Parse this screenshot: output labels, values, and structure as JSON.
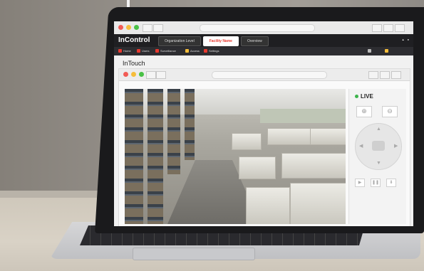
{
  "app": {
    "logo": "InControl",
    "crumbs": [
      "Organization Level",
      "Facility Name",
      "Overview"
    ],
    "toolbar": [
      "Home",
      "Users",
      "Surveillance",
      "Access",
      "Settings"
    ],
    "page_title": "InTouch",
    "live_label": "LIVE"
  },
  "colors": {
    "accent_red": "#e8392f",
    "live_green": "#3cb44b",
    "dot_red": "#f25b55",
    "dot_yellow": "#f6bd3b",
    "dot_green": "#49c146"
  },
  "icons": {
    "zoom_in": "zoom-in-icon",
    "zoom_out": "zoom-out-icon",
    "camera": "camera-icon",
    "play": "play-icon",
    "pause": "pause-icon",
    "download": "download-icon"
  }
}
